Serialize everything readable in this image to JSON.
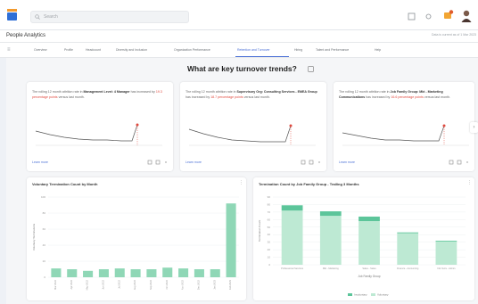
{
  "header": {
    "search_placeholder": "Search",
    "app_title": "People Analytics",
    "subbar_right": "Data is current as of 1 Mar 2023"
  },
  "tabs": [
    {
      "label": "Overview"
    },
    {
      "label": "Profile"
    },
    {
      "label": "Headcount"
    },
    {
      "label": "Diversity and Inclusion"
    },
    {
      "label": "Organization Performance"
    },
    {
      "label": "Retention and Turnover",
      "active": true
    },
    {
      "label": "Hiring"
    },
    {
      "label": "Talent and Performance"
    },
    {
      "label": "Help"
    }
  ],
  "headline": "What are key turnover trends?",
  "insight_cards": [
    {
      "pre": "The rolling 12 month attrition rate in ",
      "highlight": "Management Level: 4 Manager",
      "mid": " has increased by ",
      "change": "19.3 percentage points",
      "post": " versus last month.",
      "link": "Learn more"
    },
    {
      "pre": "The rolling 12 month attrition rate in ",
      "highlight": "Supervisory Org: Consulting Services - EMEA Group",
      "mid": " has increased by ",
      "change": "18.7 percentage points",
      "post": " versus last month.",
      "link": "Learn more"
    },
    {
      "pre": "The rolling 12 month attrition rate in ",
      "highlight": "Job Family Group: Mkt - Marketing Communications",
      "mid": " has increased by ",
      "change": "16.6 percentage points",
      "post": " versus last month.",
      "link": "Learn more"
    }
  ],
  "chart_data": [
    {
      "type": "bar",
      "title": "Voluntary Termination Count by Month",
      "ylabel": "Voluntary Terminations",
      "xlabel": "",
      "ylim": [
        0,
        100
      ],
      "categories": [
        "Mar 2022",
        "Apr 2022",
        "May 2022",
        "Jun 2022",
        "Jul 2022",
        "Aug 2022",
        "Sep 2022",
        "Oct 2022",
        "Nov 2022",
        "Dec 2022",
        "Jan 2023",
        "Feb 2023"
      ],
      "values": [
        11,
        10,
        8,
        10,
        11,
        10,
        10,
        12,
        11,
        10,
        10,
        92
      ],
      "color": "#8fd7b6"
    },
    {
      "type": "bar",
      "stacked": true,
      "title": "Termination Count by Job Family Group - Trailing 3 Months",
      "xlabel": "Job Family Group",
      "ylabel": "Termination Count",
      "ylim": [
        0,
        90
      ],
      "categories": [
        "Professional Services - Consulting",
        "Mkt - Marketing",
        "Sales - Sales",
        "Finance - Accounting",
        "Info Svcs - Admin"
      ],
      "series": [
        {
          "name": "Involuntary",
          "values": [
            7,
            6,
            6,
            1,
            1
          ],
          "color": "#5cc59a"
        },
        {
          "name": "Voluntary",
          "values": [
            72,
            65,
            58,
            42,
            31
          ],
          "color": "#bde9d3"
        }
      ],
      "legend": "bottom"
    }
  ]
}
